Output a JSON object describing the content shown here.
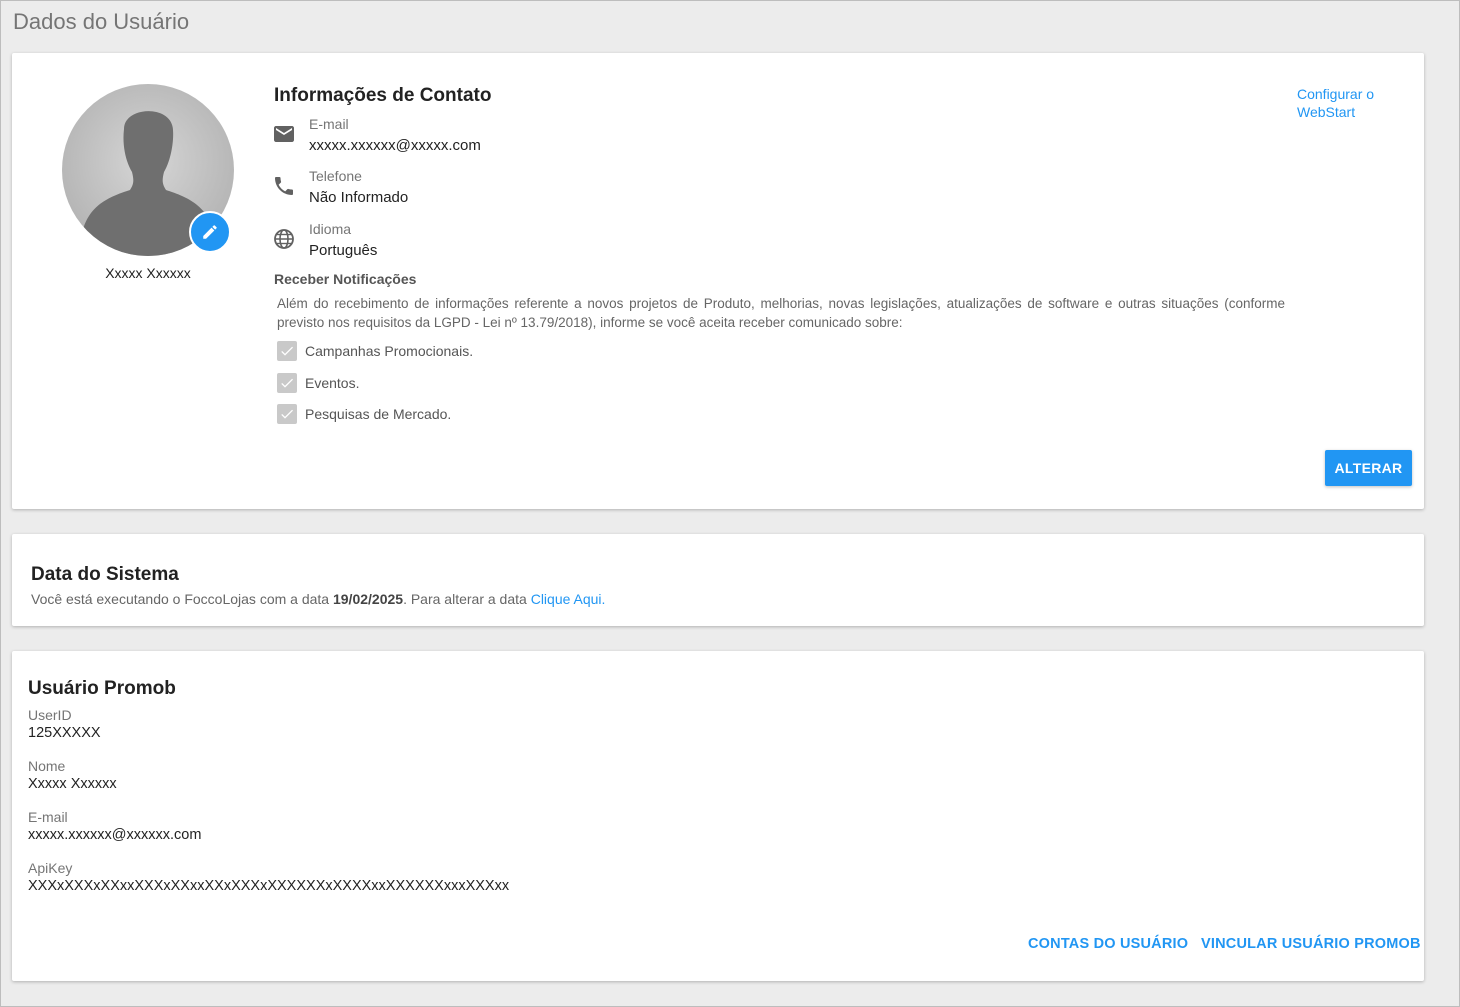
{
  "page": {
    "title": "Dados do Usuário"
  },
  "profile": {
    "name": "Xxxxx Xxxxxx",
    "contact_title": "Informações de Contato",
    "webstart_link": "Configurar o WebStart",
    "email": {
      "label": "E-mail",
      "value": "xxxxx.xxxxxx@xxxxx.com",
      "icon": "mail-icon"
    },
    "phone": {
      "label": "Telefone",
      "value": "Não Informado",
      "icon": "phone-icon"
    },
    "language": {
      "label": "Idioma",
      "value": "Português",
      "icon": "globe-icon"
    },
    "notifications": {
      "title": "Receber Notificações",
      "description": "Além do recebimento de informações referente a novos projetos de Produto, melhorias, novas legislações, atualizações de software e outras situações (conforme previsto nos requisitos da LGPD - Lei nº 13.79/2018), informe se você aceita receber comunicado sobre:",
      "options": [
        {
          "label": "Campanhas Promocionais.",
          "checked": true
        },
        {
          "label": "Eventos.",
          "checked": true
        },
        {
          "label": "Pesquisas de Mercado.",
          "checked": true
        }
      ]
    },
    "change_button": "ALTERAR"
  },
  "system_date": {
    "title": "Data do Sistema",
    "text_before": "Você está executando o FoccoLojas com a data ",
    "date": "19/02/2025",
    "text_after": ". Para alterar a data ",
    "link": "Clique Aqui."
  },
  "promob": {
    "title": "Usuário Promob",
    "fields": [
      {
        "label": "UserID",
        "value": "125XXXXX"
      },
      {
        "label": "Nome",
        "value": "Xxxxx Xxxxxx"
      },
      {
        "label": "E-mail",
        "value": "xxxxx.xxxxxx@xxxxxx.com"
      },
      {
        "label": "ApiKey",
        "value": "XXXxXXXxXXxxXXXxXXxxXXxXXXxXXXXXXxXXXXxxXXXXXXxxxXXXxx"
      }
    ],
    "accounts_button": "CONTAS DO USUÁRIO",
    "link_button": "VINCULAR USUÁRIO PROMOB"
  },
  "colors": {
    "accent": "#2196f3",
    "background": "#ececec",
    "check_disabled": "#c9c9c9"
  }
}
